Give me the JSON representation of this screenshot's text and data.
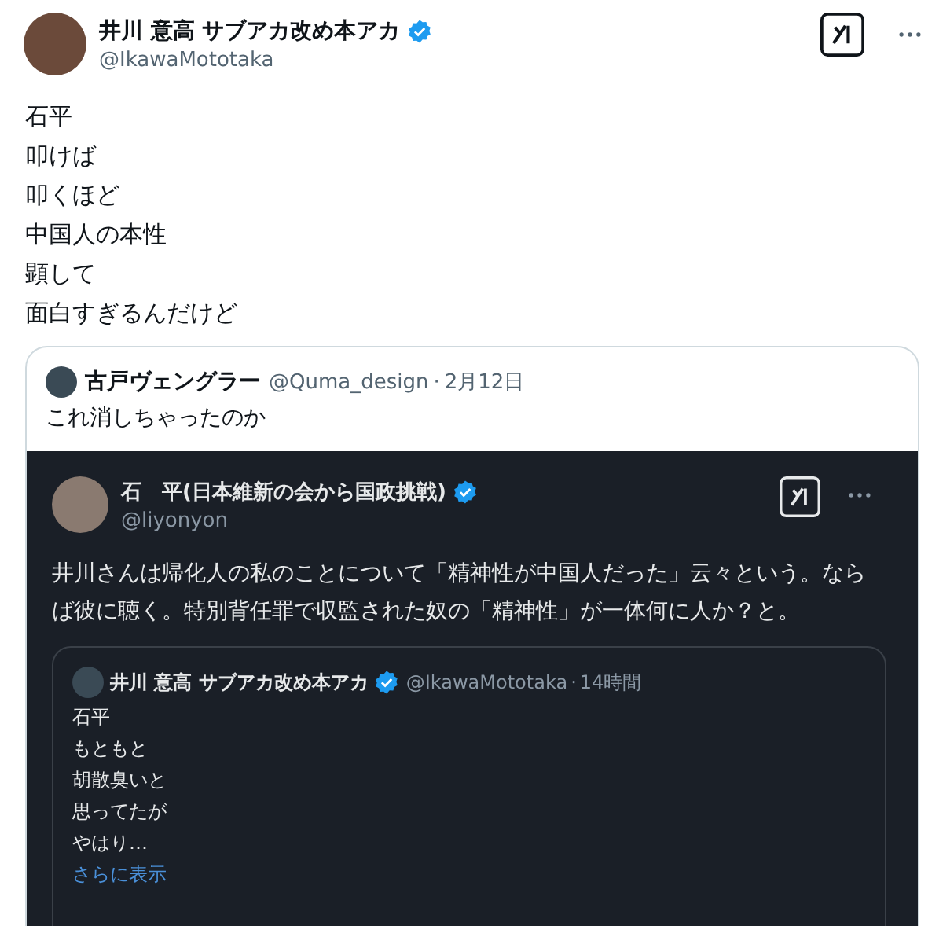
{
  "post": {
    "author": {
      "name": "井川 意高 サブアカ改め本アカ",
      "verified": true,
      "handle": "@IkawaMototaka"
    },
    "lines": [
      "石平",
      "叩けば",
      "叩くほど",
      "中国人の本性",
      "顕して",
      "面白すぎるんだけど"
    ],
    "quote": {
      "author": {
        "name": "古戸ヴェングラー",
        "handle": "@Quma_design",
        "separator": "·",
        "date": "2月12日"
      },
      "text": "これ消しちゃったのか",
      "screenshot": {
        "author": {
          "name": "石　平(日本維新の会から国政挑戦)",
          "verified": true,
          "handle": "@liyonyon"
        },
        "text": "井川さんは帰化人の私のことについて「精神性が中国人だった」云々という。ならば彼に聴く。特別背任罪で収監された奴の「精神性」が一体何に人か？と。",
        "quote": {
          "author": {
            "name": "井川 意高 サブアカ改め本アカ",
            "verified": true,
            "handle": "@IkawaMototaka",
            "separator": "·",
            "time": "14時間"
          },
          "lines": [
            "石平",
            "もともと",
            "胡散臭いと",
            "思ってたが",
            "やはり…"
          ],
          "more": "さらに表示"
        }
      }
    }
  }
}
